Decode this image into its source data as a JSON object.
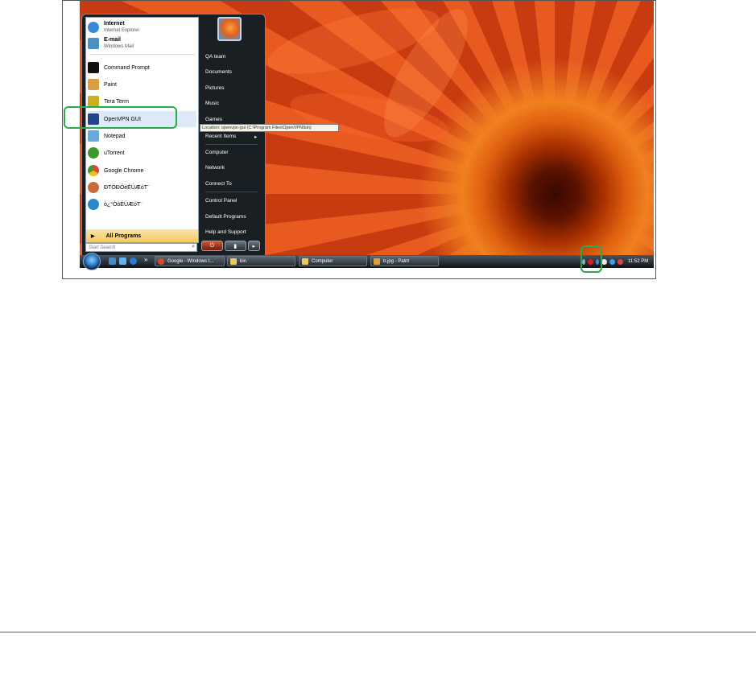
{
  "start_menu": {
    "pinned": [
      {
        "name": "Internet",
        "sub": "Internet Explorer",
        "icon": "internet-explorer-icon",
        "color": "#3a8ad8"
      },
      {
        "name": "E-mail",
        "sub": "Windows Mail",
        "icon": "windows-mail-icon",
        "color": "#4a90c0"
      }
    ],
    "recent": [
      {
        "name": "Command Prompt",
        "icon": "command-prompt-icon",
        "color": "#111111"
      },
      {
        "name": "Paint",
        "icon": "paint-icon",
        "color": "#d8a040"
      },
      {
        "name": "Tera Term",
        "icon": "tera-term-icon",
        "color": "#c8b020"
      },
      {
        "name": "OpenVPN GUI",
        "icon": "openvpn-icon",
        "color": "#224488"
      },
      {
        "name": "Notepad",
        "icon": "notepad-icon",
        "color": "#6aa8d8"
      },
      {
        "name": "uTorrent",
        "icon": "utorrent-icon",
        "color": "#3a9a2a"
      },
      {
        "name": "Google Chrome",
        "icon": "chrome-icon",
        "color": "#d84a2a"
      },
      {
        "name": "ÐTÖÐÖéÉÚÆóT¨",
        "icon": "app-icon",
        "color": "#c86a3a"
      },
      {
        "name": "ò¿°ÒóÉÚÆóT¨",
        "icon": "app-v-icon",
        "color": "#2a8ac8"
      }
    ],
    "all_programs": "All Programs",
    "search_placeholder": "Start Search",
    "right_links": [
      "QA team",
      "Documents",
      "Pictures",
      "Music",
      "Games",
      "Recent Items",
      "Computer",
      "Network",
      "Connect To",
      "Control Panel",
      "Default Programs",
      "Help and Support"
    ],
    "tooltip": "Location: openvpn-gui (C:\\Program Files\\OpenVPN\\bin)",
    "power_glyph": "⏻",
    "lock_glyph": "▮",
    "arrow_glyph": "▸"
  },
  "taskbar": {
    "buttons": [
      {
        "label": "Google - Windows I...",
        "icon": "chrome-icon"
      },
      {
        "label": "bin",
        "icon": "folder-icon"
      },
      {
        "label": "Computer",
        "icon": "folder-icon"
      },
      {
        "label": "b.jpg - Paint",
        "icon": "paint-icon"
      }
    ],
    "overflow": "»",
    "clock": "11:52 PM"
  },
  "colors": {
    "highlight": "#2fa84a",
    "menu_dark": "#1a1f24"
  }
}
